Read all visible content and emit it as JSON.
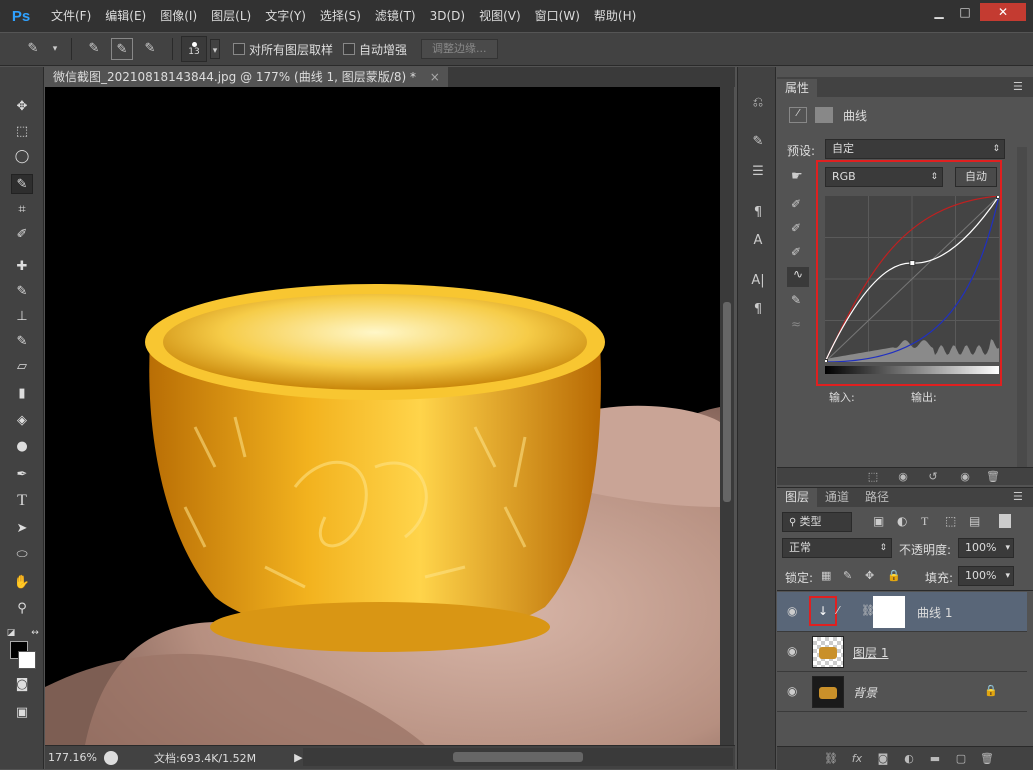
{
  "app": {
    "logo": "Ps"
  },
  "menu": [
    "文件(F)",
    "编辑(E)",
    "图像(I)",
    "图层(L)",
    "文字(Y)",
    "选择(S)",
    "滤镜(T)",
    "3D(D)",
    "视图(V)",
    "窗口(W)",
    "帮助(H)"
  ],
  "window_controls": {
    "minimize": "▁",
    "maximize": "□",
    "close": "✕"
  },
  "options": {
    "brush_size": "13",
    "sample_all_layers": "对所有图层取样",
    "auto_enhance": "自动增强",
    "refine_edge": "调整边缘..."
  },
  "document": {
    "tab_title": "微信截图_20210818143844.jpg @ 177% (曲线 1, 图层蒙版/8) *",
    "tab_close": "×",
    "zoom": "177.16%",
    "doc_info": "文档:693.4K/1.52M"
  },
  "properties": {
    "tab_label": "属性",
    "panel_title": "曲线",
    "preset_label": "预设:",
    "preset_value": "自定",
    "channel_value": "RGB",
    "auto_label": "自动",
    "input_label": "输入:",
    "output_label": "输出:"
  },
  "layers_panel": {
    "tabs": [
      "图层",
      "通道",
      "路径"
    ],
    "filter_label": "类型",
    "blend_mode": "正常",
    "opacity_label": "不透明度:",
    "opacity_value": "100%",
    "lock_label": "锁定:",
    "fill_label": "填充:",
    "fill_value": "100%",
    "layers": [
      {
        "name": "曲线 1",
        "selected": true
      },
      {
        "name": "图层 1",
        "selected": false
      },
      {
        "name": "背景",
        "selected": false
      }
    ]
  },
  "colors": {
    "accent": "#2fa1ff",
    "highlight": "#e02020",
    "selected_layer": "#596678"
  },
  "chart_data": {
    "type": "line",
    "series": [
      {
        "values": [
          [
            0,
            0
          ],
          [
            128,
            152
          ],
          [
            255,
            255
          ]
        ]
      }
    ],
    "xlim": [
      0,
      255
    ],
    "ylim": [
      0,
      255
    ],
    "grid": true
  }
}
